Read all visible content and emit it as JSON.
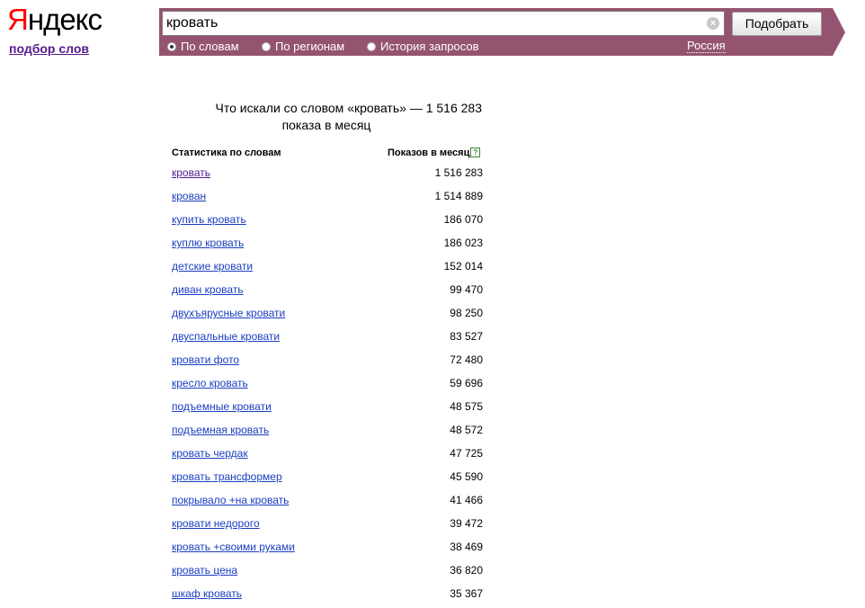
{
  "header": {
    "logo_first": "Я",
    "logo_rest": "ндекс",
    "service_link": "подбор слов",
    "search_value": "кровать",
    "submit_label": "Подобрать",
    "tabs": [
      {
        "label": "По словам",
        "checked": true
      },
      {
        "label": "По регионам",
        "checked": false
      },
      {
        "label": "История запросов",
        "checked": false
      }
    ],
    "region": "Россия",
    "clear_symbol": "×"
  },
  "colors": {
    "bar": "#94546f",
    "link": "#1a3dc1",
    "visited_link": "#551a8b",
    "logo_red": "#ff0000"
  },
  "summary": {
    "line1": "Что искали со словом «кровать» — 1 516 283",
    "line2": "показа в месяц"
  },
  "table": {
    "col_keyword": "Статистика по словам",
    "col_count": "Показов в месяц",
    "help_symbol": "?",
    "rows": [
      {
        "keyword": "кровать",
        "count": "1 516 283"
      },
      {
        "keyword": "крован",
        "count": "1 514 889"
      },
      {
        "keyword": "купить кровать",
        "count": "186 070"
      },
      {
        "keyword": "куплю кровать",
        "count": "186 023"
      },
      {
        "keyword": "детские кровати",
        "count": "152 014"
      },
      {
        "keyword": "диван кровать",
        "count": "99 470"
      },
      {
        "keyword": "двухъярусные кровати",
        "count": "98 250"
      },
      {
        "keyword": "двуспальные кровати",
        "count": "83 527"
      },
      {
        "keyword": "кровати фото",
        "count": "72 480"
      },
      {
        "keyword": "кресло кровать",
        "count": "59 696"
      },
      {
        "keyword": "подъемные кровати",
        "count": "48 575"
      },
      {
        "keyword": "подъемная кровать",
        "count": "48 572"
      },
      {
        "keyword": "кровать чердак",
        "count": "47 725"
      },
      {
        "keyword": "кровать трансформер",
        "count": "45 590"
      },
      {
        "keyword": "покрывало +на кровать",
        "count": "41 466"
      },
      {
        "keyword": "кровати недорого",
        "count": "39 472"
      },
      {
        "keyword": "кровать +своими руками",
        "count": "38 469"
      },
      {
        "keyword": "кровать цена",
        "count": "36 820"
      },
      {
        "keyword": "шкаф кровать",
        "count": "35 367"
      }
    ]
  }
}
